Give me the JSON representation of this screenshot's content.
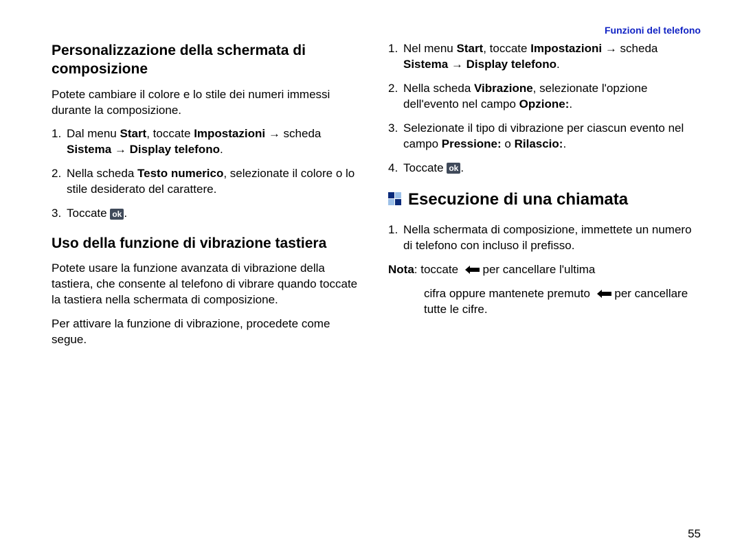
{
  "header": {
    "label": "Funzioni del telefono"
  },
  "left": {
    "sub1": {
      "title": "Personalizzazione della schermata di composizione",
      "intro": "Potete cambiare il colore e lo stile dei numeri immessi durante la composizione.",
      "step1_a": "Dal menu ",
      "step1_b": "Start",
      "step1_c": ", toccate ",
      "step1_d": "Impostazioni",
      "step1_e": " → scheda ",
      "step1_f": "Sistema",
      "step1_g": " → ",
      "step1_h": "Display telefono",
      "step1_i": ".",
      "step2_a": "Nella scheda ",
      "step2_b": "Testo numerico",
      "step2_c": ", selezionate il colore o lo stile desiderato del carattere.",
      "step3_a": "Toccate ",
      "step3_b": "."
    },
    "sub2": {
      "title": "Uso della funzione di vibrazione tastiera",
      "p1": "Potete usare la funzione avanzata di vibrazione della tastiera, che consente al telefono di vibrare quando toccate la tastiera nella schermata di composizione.",
      "p2": "Per attivare la funzione di vibrazione, procedete come segue."
    }
  },
  "right": {
    "step1_a": "Nel menu ",
    "step1_b": "Start",
    "step1_c": ", toccate ",
    "step1_d": "Impostazioni",
    "step1_e": " → scheda ",
    "step1_f": "Sistema",
    "step1_g": " → ",
    "step1_h": "Display telefono",
    "step1_i": ".",
    "step2_a": "Nella scheda ",
    "step2_b": "Vibrazione",
    "step2_c": ", selezionate l'opzione dell'evento nel campo ",
    "step2_d": "Opzione:",
    "step2_e": ".",
    "step3_a": "Selezionate il tipo di vibrazione per ciascun evento nel campo ",
    "step3_b": "Pressione:",
    "step3_c": " o ",
    "step3_d": "Rilascio:",
    "step3_e": ".",
    "step4_a": "Toccate ",
    "step4_b": ".",
    "section": {
      "title": "Esecuzione di una chiamata",
      "step1": "Nella schermata di composizione, immettete un numero di telefono con incluso il prefisso.",
      "note_a": "Nota",
      "note_b": ": toccate ",
      "note_c": " per cancellare l'ultima",
      "note_d": "cifra oppure mantenete premuto ",
      "note_e": " per cancellare tutte le cifre."
    }
  },
  "footer": {
    "page": "55"
  },
  "icons": {
    "ok": "ok"
  }
}
